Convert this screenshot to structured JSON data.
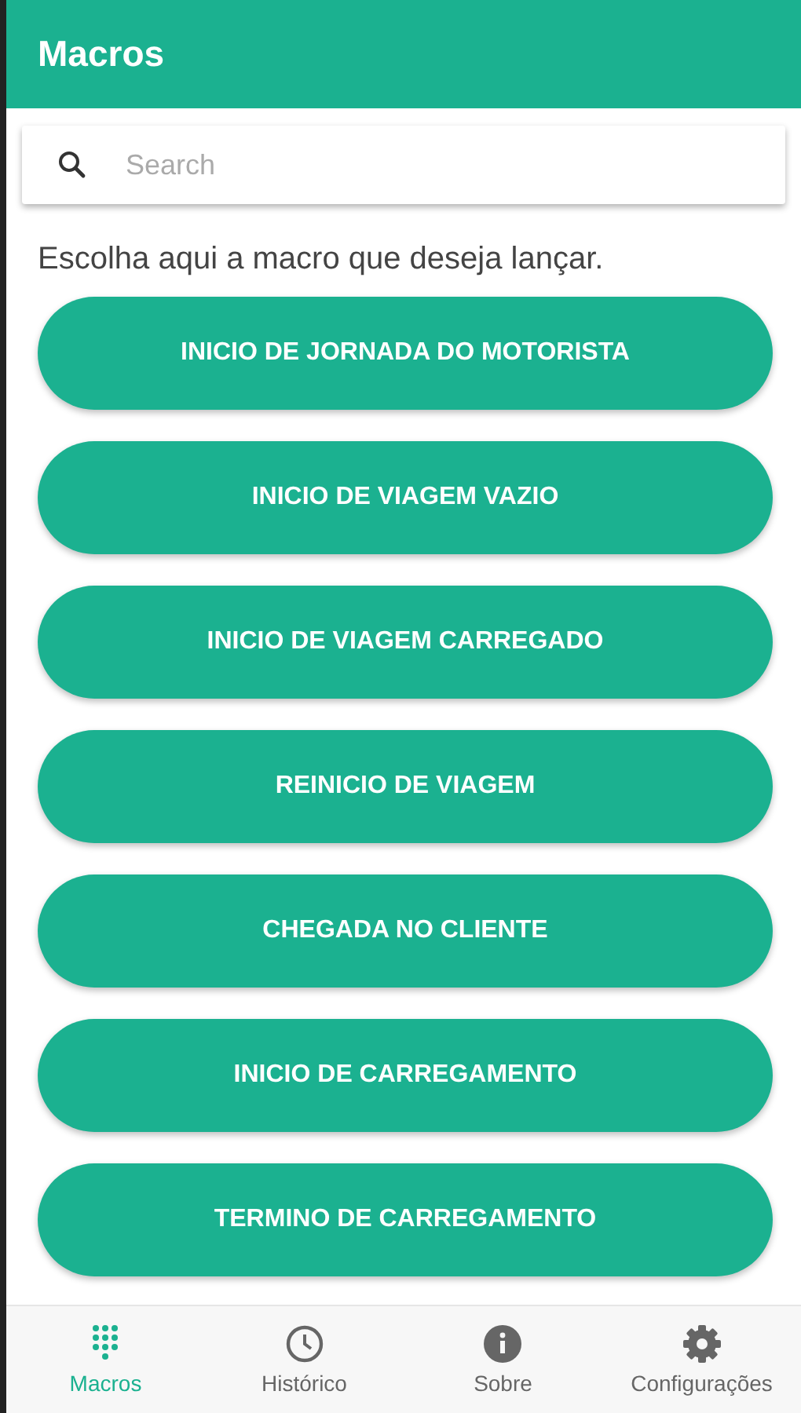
{
  "app_bar": {
    "title": "Macros"
  },
  "search": {
    "placeholder": "Search"
  },
  "instruction": "Escolha aqui a macro que deseja lançar.",
  "macros": [
    "INICIO DE JORNADA DO MOTORISTA",
    "INICIO DE VIAGEM VAZIO",
    "INICIO DE VIAGEM CARREGADO",
    "REINICIO DE VIAGEM",
    "CHEGADA NO CLIENTE",
    "INICIO DE CARREGAMENTO",
    "TERMINO DE CARREGAMENTO"
  ],
  "bottom_nav": [
    {
      "label": "Macros",
      "kind": "dialpad",
      "selected": true
    },
    {
      "label": "Histórico",
      "kind": "clock",
      "selected": false
    },
    {
      "label": "Sobre",
      "kind": "info",
      "selected": false
    },
    {
      "label": "Configurações",
      "kind": "gear",
      "selected": false
    }
  ]
}
